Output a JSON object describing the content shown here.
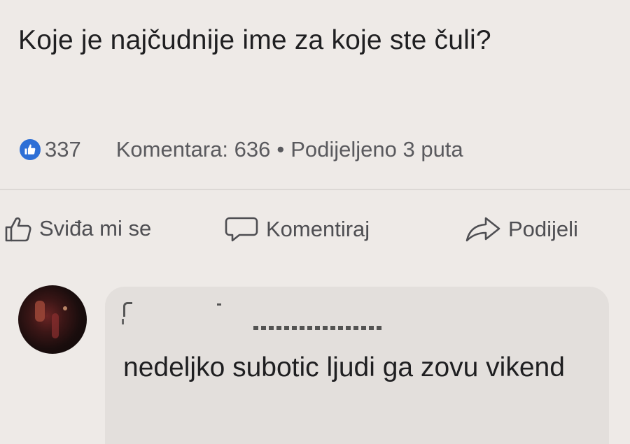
{
  "post": {
    "text": "Koje je najčudnije ime za koje ste čuli?",
    "likes_count": "337",
    "comments_text": "Komentara: 636",
    "separator": "•",
    "shares_text": "Podijeljeno 3 puta"
  },
  "actions": {
    "like_label": "Sviđa mi se",
    "comment_label": "Komentiraj",
    "share_label": "Podijeli"
  },
  "comment": {
    "text": "nedeljko subotic ljudi ga zovu vikend"
  },
  "colors": {
    "background": "#eeeae7",
    "like_badge": "#2d6fd6",
    "comment_bubble": "#e3dfdc"
  }
}
